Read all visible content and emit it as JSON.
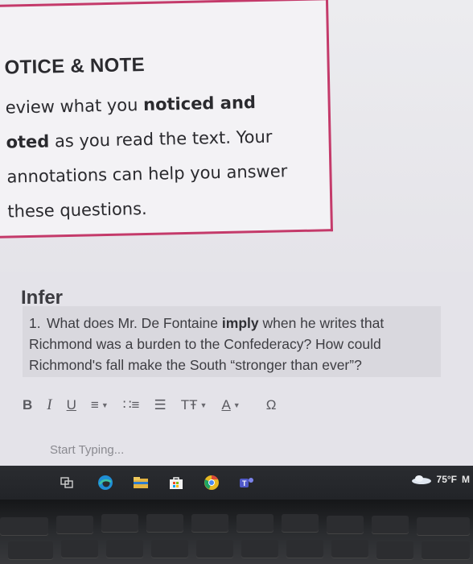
{
  "notice": {
    "title": "OTICE & NOTE",
    "line1_pre": "eview what you ",
    "line1_bold": "noticed and",
    "line2_bold": "oted",
    "line2_post": " as you read the text. Your",
    "line3": "annotations can help you answer",
    "line4": "these questions."
  },
  "question": {
    "heading": "Infer",
    "number": "1.",
    "text_pre": "What does Mr. De Fontaine ",
    "text_bold": "imply",
    "text_post": " when he writes that Richmond was a burden to the Confederacy? How could Richmond's fall make the South “stronger than ever”?"
  },
  "toolbar": {
    "bold": "B",
    "italic": "I",
    "underline": "U",
    "align": "≡",
    "bullets": "∷≡",
    "numbered": "☰",
    "text_size": "TŦ",
    "font_color": "A",
    "special_chars": "Ω"
  },
  "editor": {
    "placeholder": "Start Typing..."
  },
  "taskbar": {
    "weather_temp": "75°F",
    "weather_suffix": "M"
  },
  "colors": {
    "card_border": "#c43a6a",
    "accent_blue": "#2f7fd8",
    "taskbar": "#25272b"
  }
}
